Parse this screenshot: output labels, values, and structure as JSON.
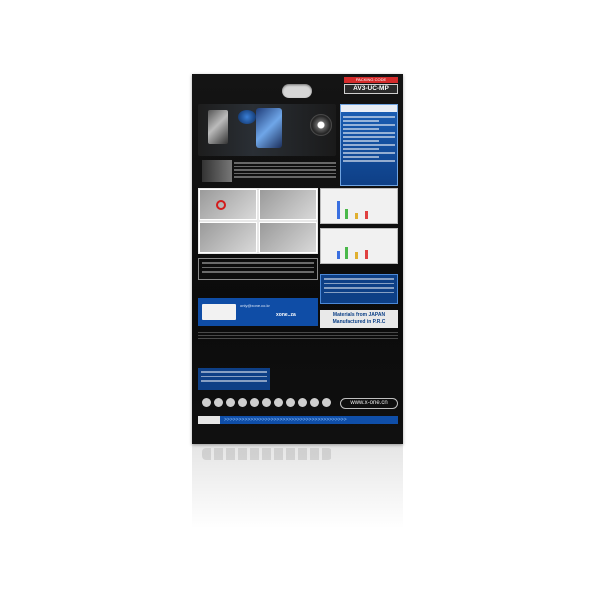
{
  "package": {
    "code_label": "PACKING CODE",
    "code": "AV3-UC-MP",
    "brand_logo_text": "X-ONE",
    "brand_url": "only@xone.co.kr",
    "brand_short": "xone..za",
    "origin_line1": "Materials from JAPAN",
    "origin_line2": "Manufactured in P.R.C",
    "website": "www.x-one.cn"
  },
  "colors": {
    "package_background": "#111111",
    "accent_blue": "#0f4da6",
    "code_label_red": "#d42b2b"
  }
}
